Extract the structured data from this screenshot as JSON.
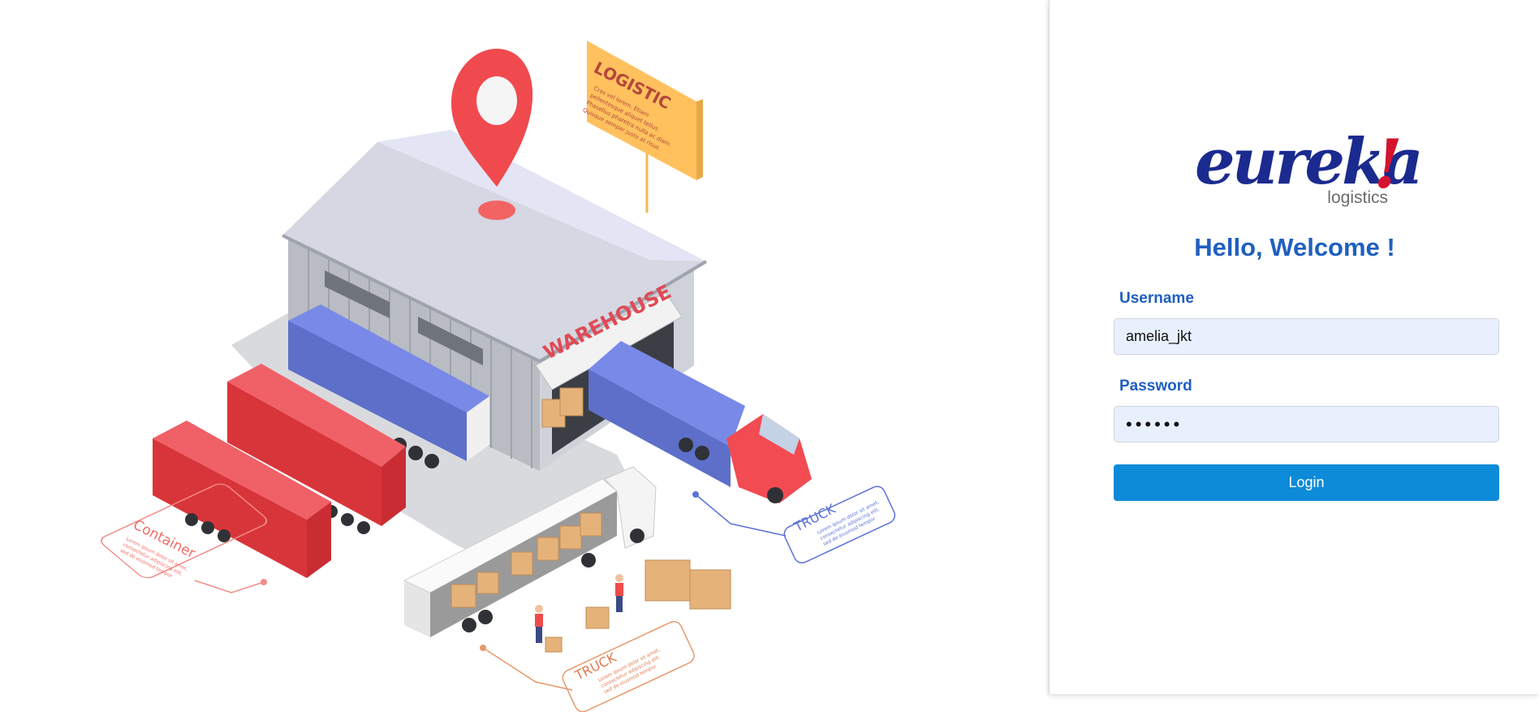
{
  "illustration": {
    "sign_title": "LOGISTIC",
    "sign_body": [
      "Cras vel lorem. Etiam",
      "pellentesque aliquet tellus.",
      "Phasellus pharetra nulla ac diam.",
      "Quisque semper justo at risus."
    ],
    "warehouse_label": "WAREHOUSE",
    "callout_container": {
      "title": "Container",
      "body": [
        "Lorem ipsum dolor sit amet,",
        "consectetur adipiscing elit,",
        "sed do eiusmod tempor"
      ]
    },
    "callout_truck_right": {
      "title": "TRUCK",
      "body": [
        "Lorem ipsum dolor sit amet,",
        "consectetur adipiscing elit,",
        "sed do eiusmod tempor"
      ]
    },
    "callout_truck_bottom": {
      "title": "TRUCK",
      "body": [
        "Lorem ipsum dolor sit amet,",
        "consectetur adipiscing elit,",
        "sed do eiusmod tempor"
      ]
    }
  },
  "logo": {
    "word": "eureka",
    "bang": "!",
    "subtitle": "logistics"
  },
  "login": {
    "welcome": "Hello, Welcome !",
    "username_label": "Username",
    "username_value": "amelia_jkt",
    "password_label": "Password",
    "password_value": "••••••",
    "button_label": "Login"
  },
  "colors": {
    "accent_blue": "#1f5fbf",
    "button_blue": "#0d8ad8",
    "input_bg": "#e8f0fe",
    "logo_blue": "#1b2a8f",
    "logo_red": "#d4132e"
  },
  "icons": [
    "map-pin-icon"
  ]
}
